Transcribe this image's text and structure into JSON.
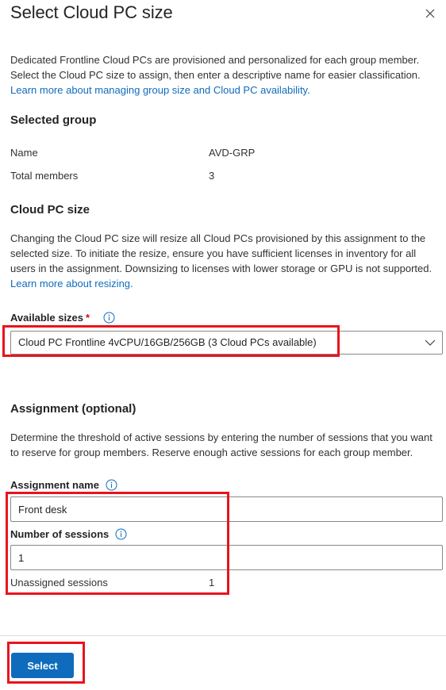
{
  "panel": {
    "title": "Select Cloud PC size",
    "intro_text": "Dedicated Frontline Cloud PCs are provisioned and personalized for each group member. Select the Cloud PC size to assign, then enter a descriptive name for easier classification.",
    "intro_link": "Learn more about managing group size and Cloud PC availability."
  },
  "selected_group": {
    "heading": "Selected group",
    "name_label": "Name",
    "name_value": "AVD-GRP",
    "members_label": "Total members",
    "members_value": "3"
  },
  "cloud_pc_size": {
    "heading": "Cloud PC size",
    "description": "Changing the Cloud PC size will resize all Cloud PCs provisioned by this assignment to the selected size. To initiate the resize, ensure you have sufficient licenses in inventory for all users in the assignment. Downsizing to licenses with lower storage or GPU is not supported.",
    "link": "Learn more about resizing.",
    "field_label": "Available sizes",
    "required_mark": "*",
    "selected_value": "Cloud PC Frontline 4vCPU/16GB/256GB (3 Cloud PCs available)"
  },
  "assignment": {
    "heading": "Assignment (optional)",
    "description": "Determine the threshold of active sessions by entering the number of sessions that you want to reserve for group members. Reserve enough active sessions for each group member.",
    "name_label": "Assignment name",
    "name_value": "Front desk",
    "sessions_label": "Number of sessions",
    "sessions_value": "1",
    "unassigned_label": "Unassigned sessions",
    "unassigned_value": "1"
  },
  "footer": {
    "select_label": "Select"
  },
  "colors": {
    "accent": "#0f6cbd",
    "highlight": "#e8141d",
    "required": "#c50f1f"
  },
  "icons": [
    "close-icon",
    "info-icon",
    "chevron-down-icon"
  ]
}
